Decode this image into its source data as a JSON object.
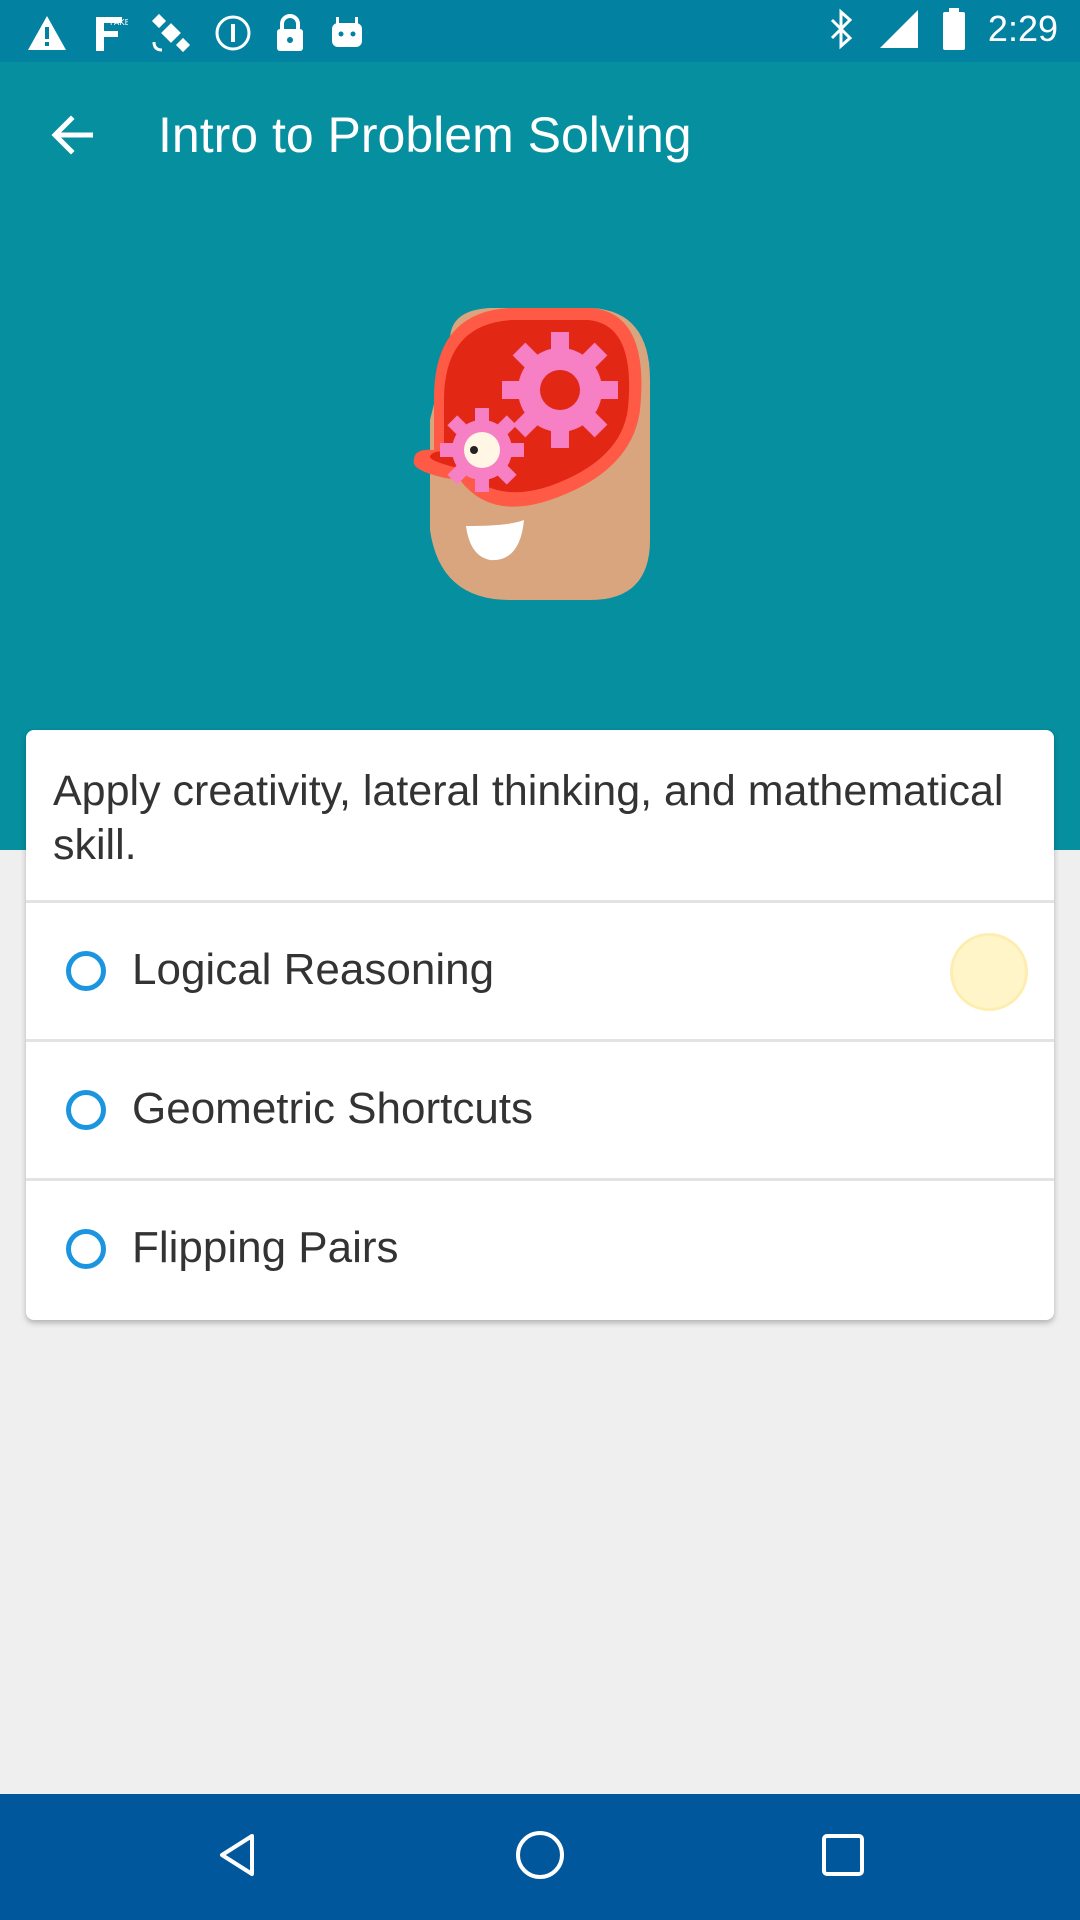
{
  "status_bar": {
    "time": "2:29",
    "left_icons": [
      "alert-icon",
      "fake-gps-icon",
      "satellite-icon",
      "circle-info-icon",
      "lock-icon",
      "android-icon"
    ],
    "right_icons": [
      "bluetooth-icon",
      "signal-icon",
      "battery-icon"
    ]
  },
  "header": {
    "title": "Intro to Problem Solving",
    "back_icon": "arrow-back-icon"
  },
  "colors": {
    "hero": "#068f9f",
    "status": "#0281a0",
    "radio": "#1c95e0",
    "navbar": "#01579b"
  },
  "card": {
    "description": "Apply creativity, lateral thinking, and mathematical skill.",
    "items": [
      {
        "label": "Logical Reasoning"
      },
      {
        "label": "Geometric Shortcuts"
      },
      {
        "label": "Flipping Pairs"
      }
    ]
  },
  "nav": {
    "buttons": [
      "back-triangle-icon",
      "home-circle-icon",
      "recents-square-icon"
    ]
  }
}
